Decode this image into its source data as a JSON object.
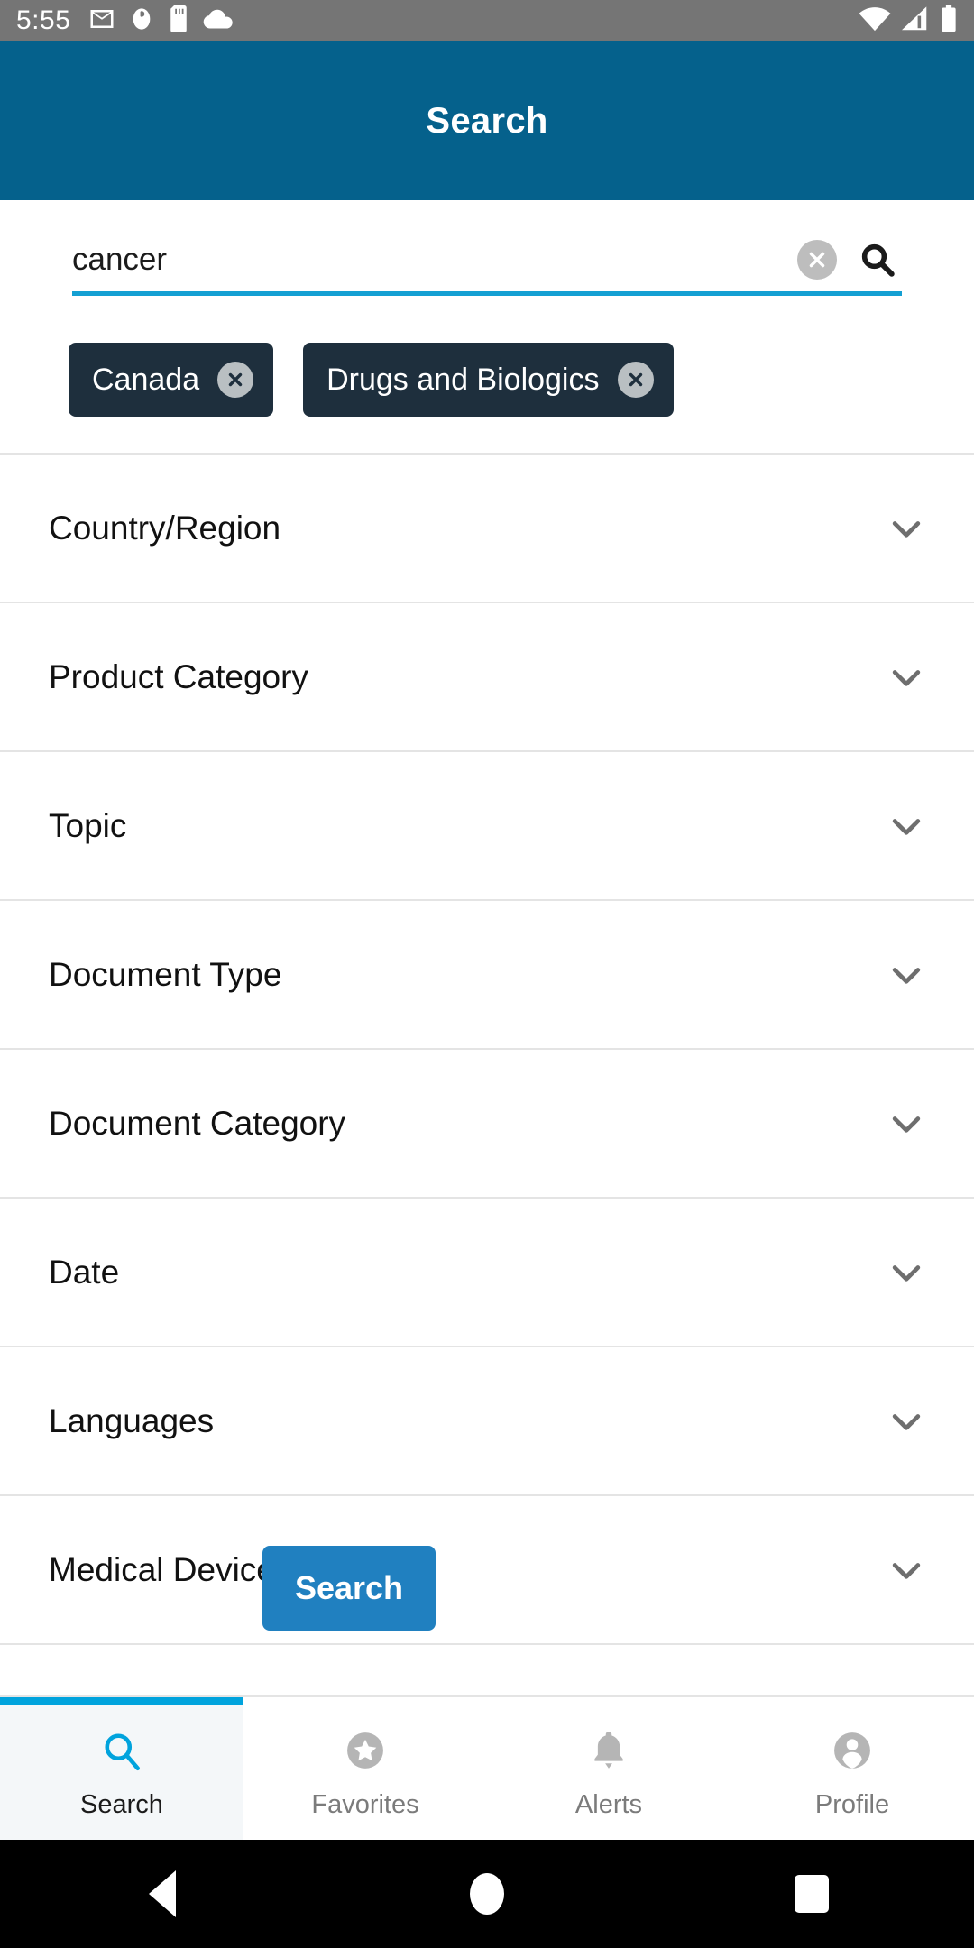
{
  "status_bar": {
    "time": "5:55",
    "left_icons": [
      "gmail-icon",
      "app-badge-icon",
      "sd-card-icon",
      "cloud-icon"
    ],
    "right_icons": [
      "wifi-icon",
      "cellular-signal-icon",
      "battery-icon"
    ]
  },
  "app_bar": {
    "title": "Search"
  },
  "search": {
    "value": "cancer",
    "placeholder": "Search",
    "clear_icon": "clear-circle-icon",
    "submit_icon": "search-icon"
  },
  "chips": [
    {
      "label": "Canada",
      "remove_icon": "remove-circle-icon"
    },
    {
      "label": "Drugs and Biologics",
      "remove_icon": "remove-circle-icon"
    }
  ],
  "facets": [
    {
      "label": "Country/Region",
      "chevron": "chevron-down-icon"
    },
    {
      "label": "Product Category",
      "chevron": "chevron-down-icon"
    },
    {
      "label": "Topic",
      "chevron": "chevron-down-icon"
    },
    {
      "label": "Document Type",
      "chevron": "chevron-down-icon"
    },
    {
      "label": "Document Category",
      "chevron": "chevron-down-icon"
    },
    {
      "label": "Date",
      "chevron": "chevron-down-icon"
    },
    {
      "label": "Languages",
      "chevron": "chevron-down-icon"
    },
    {
      "label": "Medical Devices Specific",
      "chevron": "chevron-down-icon"
    }
  ],
  "search_button": {
    "label": "Search"
  },
  "bottom_nav": [
    {
      "label": "Search",
      "icon": "search-icon",
      "active": true
    },
    {
      "label": "Favorites",
      "icon": "star-icon",
      "active": false
    },
    {
      "label": "Alerts",
      "icon": "bell-icon",
      "active": false
    },
    {
      "label": "Profile",
      "icon": "person-icon",
      "active": false
    }
  ],
  "android_nav": {
    "back": "back-triangle-icon",
    "home": "home-circle-icon",
    "recents": "recents-square-icon"
  },
  "colors": {
    "app_bar": "#05618c",
    "accent": "#00a3dd",
    "chip_bg": "#1e2f3d",
    "primary_button": "#2080c0",
    "status_bar": "#757575",
    "divider": "#e4e4e4"
  }
}
